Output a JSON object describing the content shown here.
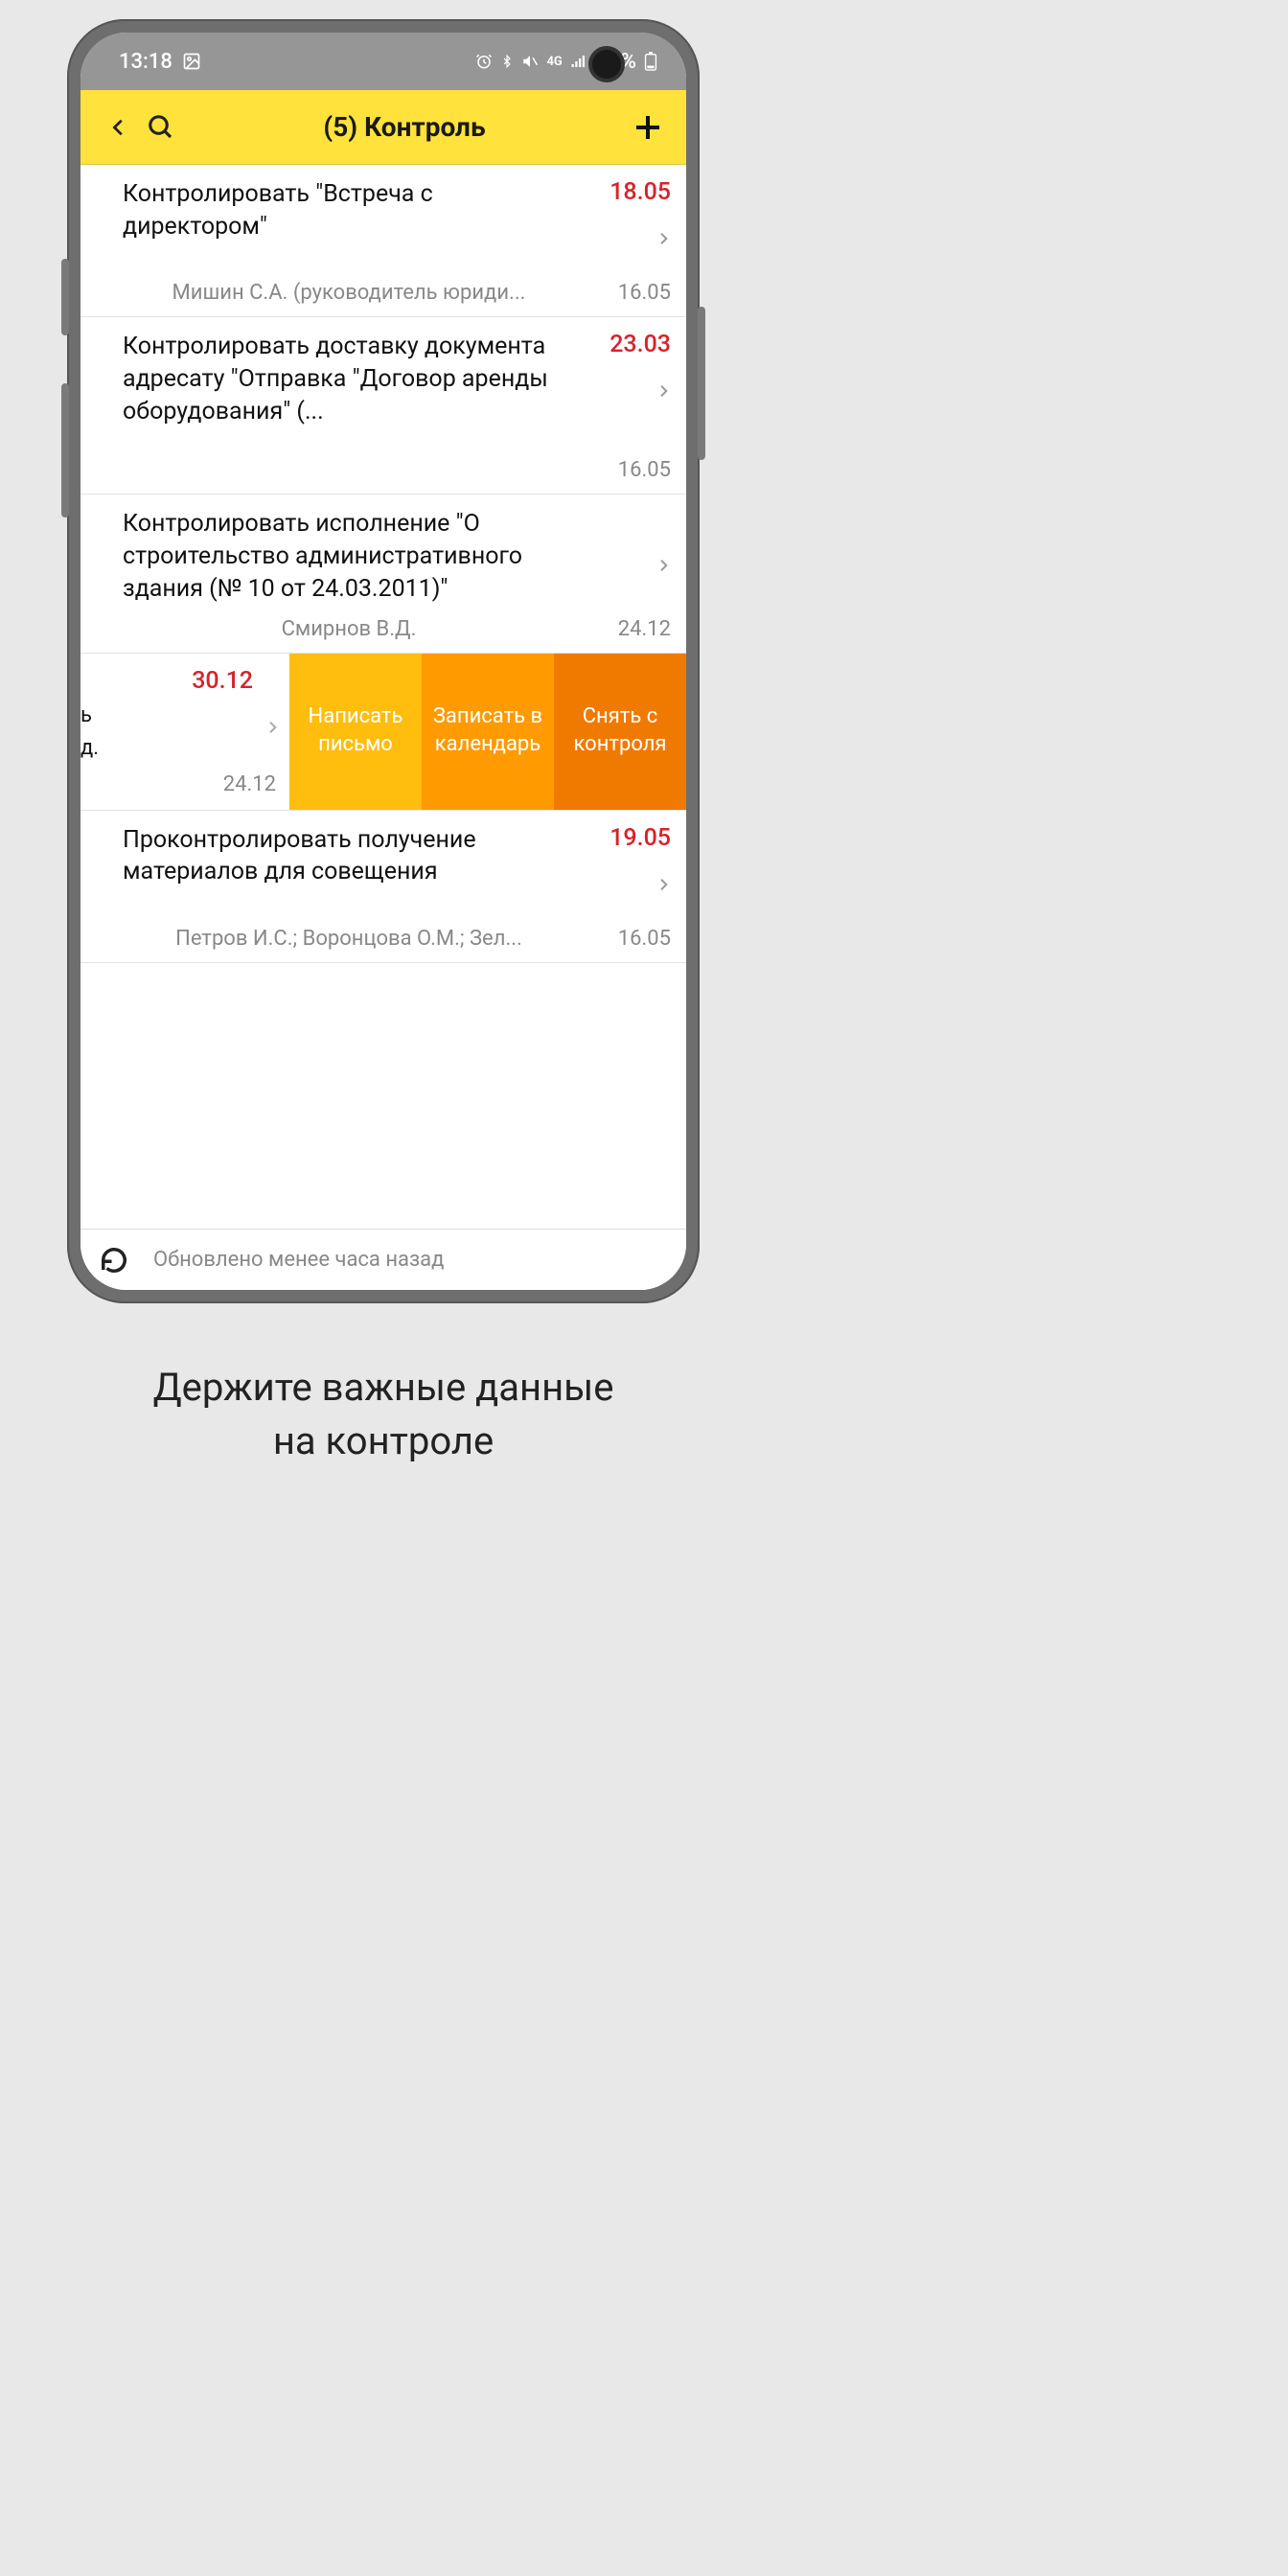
{
  "status_bar": {
    "time": "13:18",
    "battery_pct": "18%"
  },
  "app_bar": {
    "title": "(5) Контроль"
  },
  "rows": [
    {
      "title": "Контролировать \"Встреча с директором\"",
      "due": "18.05",
      "due_red": true,
      "assignee": "Мишин С.А. (руководитель юриди...",
      "date2": "16.05"
    },
    {
      "title": "Контролировать доставку документа адресату \"Отправка \"Договор аренды оборудования\" (...",
      "due": "23.03",
      "due_red": true,
      "assignee": "",
      "date2": "16.05"
    },
    {
      "title": "Контролировать исполнение \"О строительство административного здания (№ 10 от 24.03.2011)\"",
      "due": "",
      "due_red": false,
      "assignee": "Смирнов В.Д.",
      "date2": "24.12"
    }
  ],
  "swiped_row": {
    "partial_text_top": "ь",
    "partial_text_bot": "д.",
    "due": "30.12",
    "date2": "24.12",
    "actions": [
      "Написать письмо",
      "Записать в календарь",
      "Снять с контроля"
    ]
  },
  "rows_after": [
    {
      "title": "Проконтролировать получение материалов для совещения",
      "due": "19.05",
      "due_red": true,
      "assignee": "Петров И.С.; Воронцова О.М.; Зел...",
      "date2": "16.05"
    }
  ],
  "bottom_bar": {
    "text": "Обновлено менее часа назад"
  },
  "caption": {
    "line1": "Держите важные данные",
    "line2": "на контроле"
  }
}
